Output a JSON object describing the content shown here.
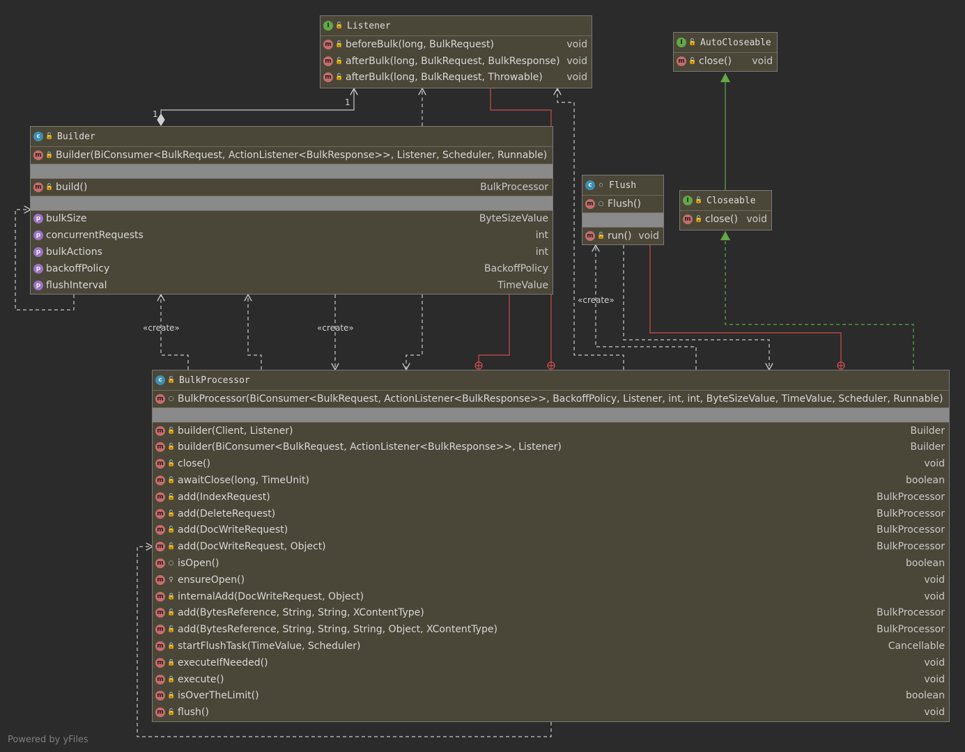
{
  "icons": {
    "method": "m",
    "property": "p",
    "class": "c",
    "interface": "I",
    "public": "public-visibility-icon",
    "private": "private-visibility-icon",
    "package": "package-visibility-icon"
  },
  "colors": {
    "background": "#2b2b2b",
    "node_fill": "#4b4738",
    "inner_class_link": "#d24c4c",
    "implements_link": "#62a845"
  },
  "listener": {
    "title": "Listener",
    "methods": [
      {
        "sig": "beforeBulk(long, BulkRequest)",
        "type": "void"
      },
      {
        "sig": "afterBulk(long, BulkRequest, BulkResponse)",
        "type": "void"
      },
      {
        "sig": "afterBulk(long, BulkRequest, Throwable)",
        "type": "void"
      }
    ]
  },
  "autocloseable": {
    "title": "AutoCloseable",
    "methods": [
      {
        "sig": "close()",
        "type": "void"
      }
    ]
  },
  "closeable": {
    "title": "Closeable",
    "methods": [
      {
        "sig": "close()",
        "type": "void"
      }
    ]
  },
  "flush": {
    "title": "Flush",
    "ctor": "Flush()",
    "methods": [
      {
        "sig": "run()",
        "type": "void"
      }
    ]
  },
  "builder": {
    "title": "Builder",
    "ctor": "Builder(BiConsumer<BulkRequest, ActionListener<BulkResponse>>, Listener, Scheduler, Runnable)",
    "methods": [
      {
        "sig": "build()",
        "type": "BulkProcessor"
      }
    ],
    "props": [
      {
        "sig": "bulkSize",
        "type": "ByteSizeValue"
      },
      {
        "sig": "concurrentRequests",
        "type": "int"
      },
      {
        "sig": "bulkActions",
        "type": "int"
      },
      {
        "sig": "backoffPolicy",
        "type": "BackoffPolicy"
      },
      {
        "sig": "flushInterval",
        "type": "TimeValue"
      }
    ]
  },
  "bulkprocessor": {
    "title": "BulkProcessor",
    "ctor": "BulkProcessor(BiConsumer<BulkRequest, ActionListener<BulkResponse>>, BackoffPolicy, Listener, int, int, ByteSizeValue, TimeValue, Scheduler, Runnable)",
    "methods": [
      {
        "sig": "builder(Client, Listener)",
        "type": "Builder"
      },
      {
        "sig": "builder(BiConsumer<BulkRequest, ActionListener<BulkResponse>>, Listener)",
        "type": "Builder"
      },
      {
        "sig": "close()",
        "type": "void"
      },
      {
        "sig": "awaitClose(long, TimeUnit)",
        "type": "boolean"
      },
      {
        "sig": "add(IndexRequest)",
        "type": "BulkProcessor"
      },
      {
        "sig": "add(DeleteRequest)",
        "type": "BulkProcessor"
      },
      {
        "sig": "add(DocWriteRequest)",
        "type": "BulkProcessor"
      },
      {
        "sig": "add(DocWriteRequest, Object)",
        "type": "BulkProcessor"
      },
      {
        "sig": "isOpen()",
        "type": "boolean"
      },
      {
        "sig": "ensureOpen()",
        "type": "void"
      },
      {
        "sig": "internalAdd(DocWriteRequest, Object)",
        "type": "void"
      },
      {
        "sig": "add(BytesReference, String, String, XContentType)",
        "type": "BulkProcessor"
      },
      {
        "sig": "add(BytesReference, String, String, String, Object, XContentType)",
        "type": "BulkProcessor"
      },
      {
        "sig": "startFlushTask(TimeValue, Scheduler)",
        "type": "Cancellable"
      },
      {
        "sig": "executeIfNeeded()",
        "type": "void"
      },
      {
        "sig": "execute()",
        "type": "void"
      },
      {
        "sig": "isOverTheLimit()",
        "type": "boolean"
      },
      {
        "sig": "flush()",
        "type": "void"
      }
    ]
  },
  "labels": {
    "multiplicity": "1",
    "create": "«create»"
  },
  "footer": "Powered by yFiles"
}
